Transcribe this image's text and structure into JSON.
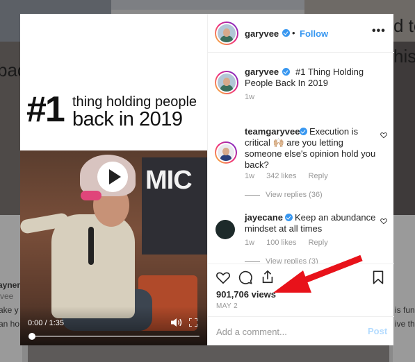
{
  "background": {
    "texts": [
      "d to",
      "bac",
      "his!!",
      "aynero",
      "vee",
      "ake y",
      "an ho",
      "is func",
      "ive th"
    ]
  },
  "media": {
    "caption_number": "#1",
    "caption_line1": "thing holding people",
    "caption_line2": "back in 2019",
    "stage_text": "MIC",
    "time": "0:00 / 1:35",
    "progress": 0.0
  },
  "header": {
    "username": "garyvee",
    "separator": "•",
    "follow_label": "Follow",
    "more_label": "•••"
  },
  "comments": [
    {
      "username": "garyvee",
      "text": "#1 Thing Holding People Back In 2019",
      "time": "1w"
    },
    {
      "username": "teamgaryvee",
      "text": "Execution is critical 🙌🏼 are you letting someone else's opinion hold you back?",
      "time": "1w",
      "likes": "342 likes",
      "reply_label": "Reply",
      "view_replies": "View replies (36)"
    },
    {
      "username": "jayecane",
      "text": "Keep an abundance mindset at all times",
      "time": "1w",
      "likes": "100 likes",
      "reply_label": "Reply",
      "view_replies": "View replies (3)"
    }
  ],
  "stats": {
    "views": "901,706 views",
    "date": "MAY 2"
  },
  "add_comment": {
    "placeholder": "Add a comment...",
    "post_label": "Post"
  },
  "colors": {
    "link_blue": "#3897f0",
    "post_disabled": "#b3dbff",
    "arrow_red": "#e8121a"
  }
}
